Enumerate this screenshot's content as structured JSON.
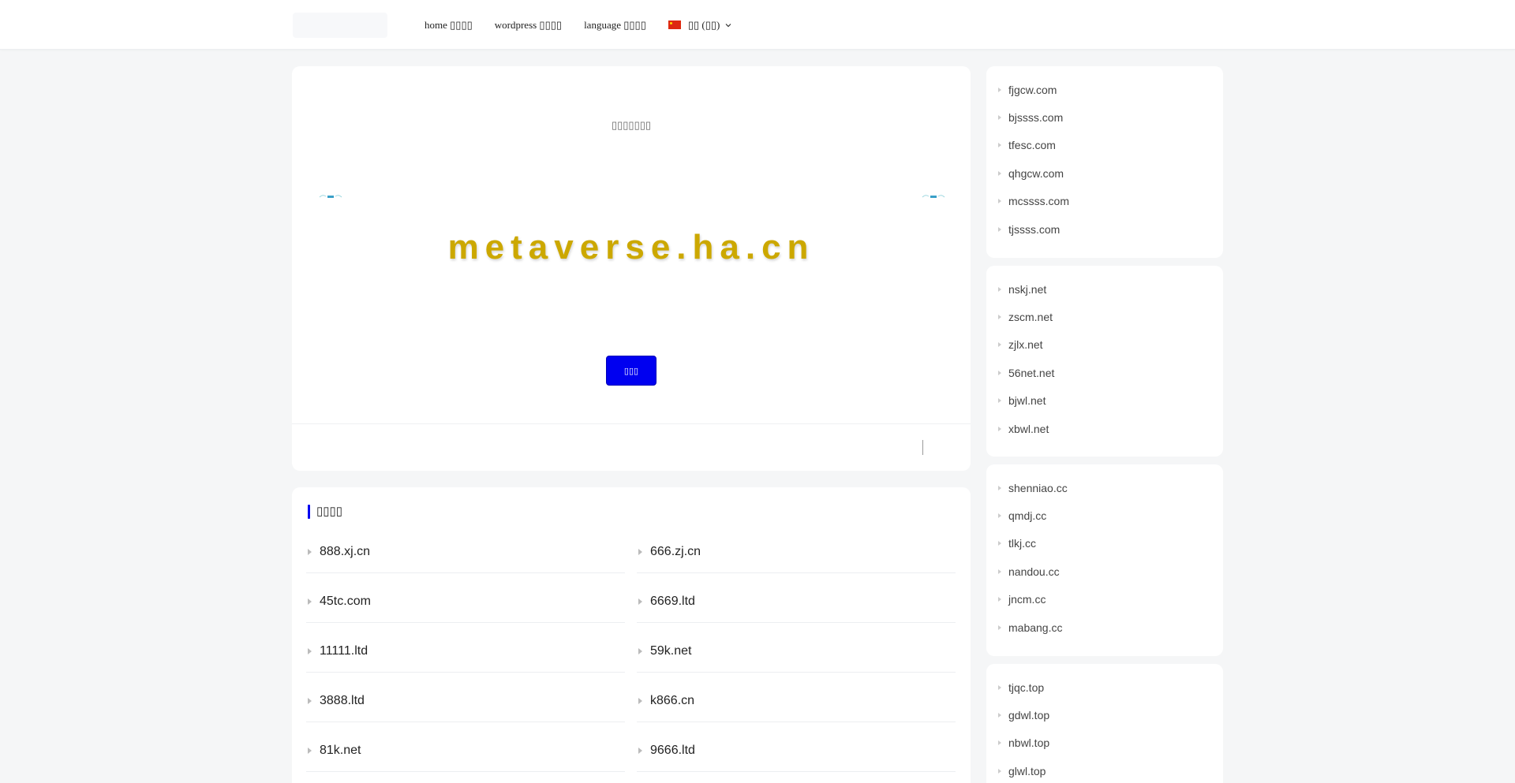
{
  "nav": {
    "items": [
      "home ▯▯▯▯",
      "wordpress ▯▯▯▯",
      "language ▯▯▯▯"
    ],
    "language_label": "▯▯ (▯▯)"
  },
  "hero": {
    "subtitle": "▯▯▯▯▯▯▯",
    "domain": "metaverse.ha.cn",
    "button_label": "▯▯▯"
  },
  "related": {
    "title": "▯▯▯▯",
    "col1": [
      "888.xj.cn",
      "45tc.com",
      "11111.ltd",
      "3888.ltd",
      "81k.net"
    ],
    "col2": [
      "666.zj.cn",
      "6669.ltd",
      "59k.net",
      "k866.cn",
      "9666.ltd"
    ]
  },
  "sidebar": {
    "groups": [
      [
        "fjgcw.com",
        "bjssss.com",
        "tfesc.com",
        "qhgcw.com",
        "mcssss.com",
        "tjssss.com"
      ],
      [
        "nskj.net",
        "zscm.net",
        "zjlx.net",
        "56net.net",
        "bjwl.net",
        "xbwl.net"
      ],
      [
        "shenniao.cc",
        "qmdj.cc",
        "tlkj.cc",
        "nandou.cc",
        "jncm.cc",
        "mabang.cc"
      ],
      [
        "tjqc.top",
        "gdwl.top",
        "nbwl.top",
        "glwl.top"
      ]
    ]
  },
  "colors": {
    "accent": "#0000f0",
    "domain_title": "#cca800",
    "background": "#f5f6f7"
  },
  "icons": {
    "language_flag": "china-flag-icon",
    "language_caret": "chevron-down-icon",
    "list_bullet": "triangle-right-icon"
  }
}
